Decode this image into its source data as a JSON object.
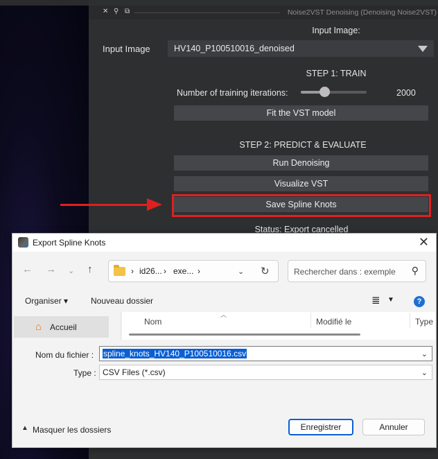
{
  "plugin": {
    "title": "Noise2VST Denoising (Denoising Noise2VST)",
    "input_image_header": "Input Image:",
    "input_image_label": "Input Image",
    "input_image_value": "HV140_P100510016_denoised",
    "step1_title": "STEP 1: TRAIN",
    "iterations_label": "Number of training iterations:",
    "iterations_value": "2000",
    "fit_button": "Fit the VST model",
    "step2_title": "STEP 2: PREDICT & EVALUATE",
    "run_button": "Run Denoising",
    "visualize_button": "Visualize VST",
    "save_button": "Save Spline Knots",
    "status": "Status: Export cancelled",
    "titlebar_icons": [
      "close-icon",
      "pin-icon",
      "float-icon"
    ]
  },
  "dialog": {
    "title": "Export Spline Knots",
    "breadcrumb": [
      "id26...",
      "exe..."
    ],
    "search_placeholder": "Rechercher dans : exemple",
    "toolbar": {
      "organize": "Organiser",
      "new_folder": "Nouveau dossier"
    },
    "nav": {
      "home": "Accueil"
    },
    "columns": [
      "Nom",
      "Modifié le",
      "Type"
    ],
    "filename_label": "Nom du fichier :",
    "filename_value": "spline_knots_HV140_P100510016.csv",
    "type_label": "Type :",
    "type_value": "CSV Files (*.csv)",
    "hide_folders": "Masquer les dossiers",
    "save_button": "Enregistrer",
    "cancel_button": "Annuler"
  },
  "colors": {
    "highlight": "#e02020",
    "plugin_bg": "#2e2f31",
    "button_bg": "#45464a",
    "accent_blue": "#0a5fd4"
  }
}
